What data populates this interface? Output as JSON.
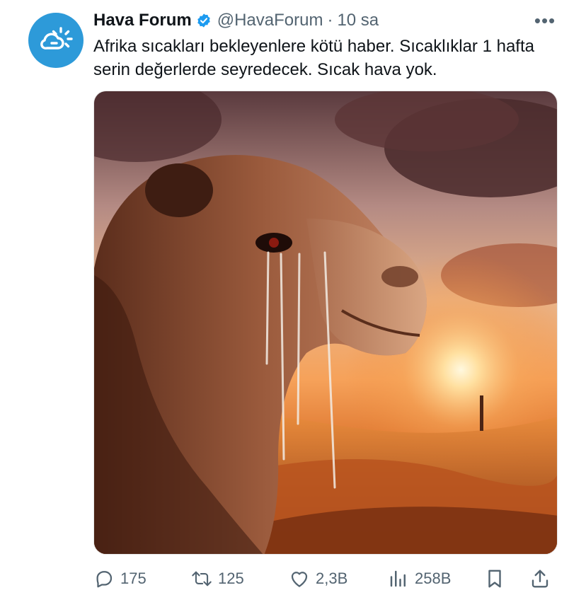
{
  "tweet": {
    "display_name": "Hava Forum",
    "handle": "@HavaForum",
    "separator": "·",
    "time": "10 sa",
    "more_label": "•••",
    "text": "Afrika sıcakları bekleyenlere kötü haber. Sıcaklıklar 1 hafta serin değerlerde seyredecek. Sıcak hava yok.",
    "avatar_icon": "cloud-sun-icon",
    "verified_icon": "verified-badge-icon",
    "media_icon": "crying-camel-desert-sunset-image"
  },
  "actions": {
    "reply": {
      "icon": "reply-icon",
      "count": "175"
    },
    "retweet": {
      "icon": "retweet-icon",
      "count": "125"
    },
    "like": {
      "icon": "heart-icon",
      "count": "2,3B"
    },
    "views": {
      "icon": "views-chart-icon",
      "count": "258B"
    },
    "bookmark": {
      "icon": "bookmark-icon"
    },
    "share": {
      "icon": "share-icon"
    }
  },
  "colors": {
    "accent": "#1d9bf0",
    "avatar_bg": "#2d9ad9",
    "text_primary": "#0f1419",
    "text_secondary": "#536471"
  }
}
